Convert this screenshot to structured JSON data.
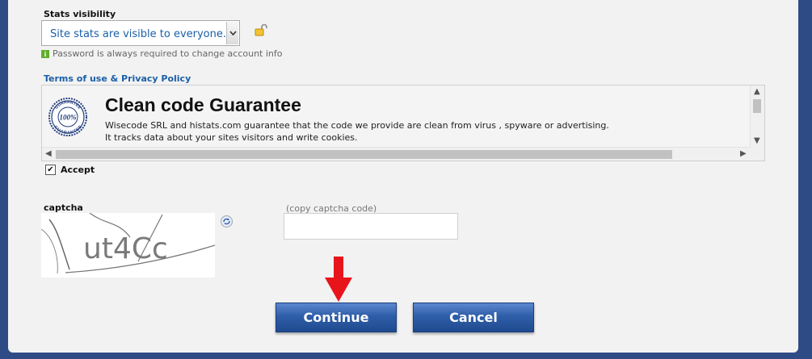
{
  "stats": {
    "label": "Stats visibility",
    "selected": "Site stats are visible to everyone.",
    "info": "Password is always required to change account info"
  },
  "terms": {
    "link": "Terms of use & Privacy Policy",
    "title": "Clean code Guarantee",
    "line1": "Wisecode SRL and histats.com guarantee that the code we provide are clean from virus , spyware or advertising.",
    "line2": "It tracks data about your sites visitors and write cookies.",
    "seal_top": "GUARANTEE",
    "seal_mid": "100%",
    "seal_bottom": "GUARANTEE"
  },
  "accept": {
    "label": "Accept",
    "checked": true
  },
  "captcha": {
    "label": "captcha",
    "image_text": "ut4Cc",
    "copy_label": "(copy captcha code)",
    "input_value": ""
  },
  "buttons": {
    "continue": "Continue",
    "cancel": "Cancel"
  },
  "colors": {
    "accent": "#1a5fa8",
    "button": "#2f5ea8",
    "arrow": "#e8141b",
    "frame": "#2f4b86"
  },
  "icons": [
    "lock-icon",
    "info-icon",
    "refresh-icon",
    "down-arrow-icon",
    "guarantee-seal-icon"
  ]
}
